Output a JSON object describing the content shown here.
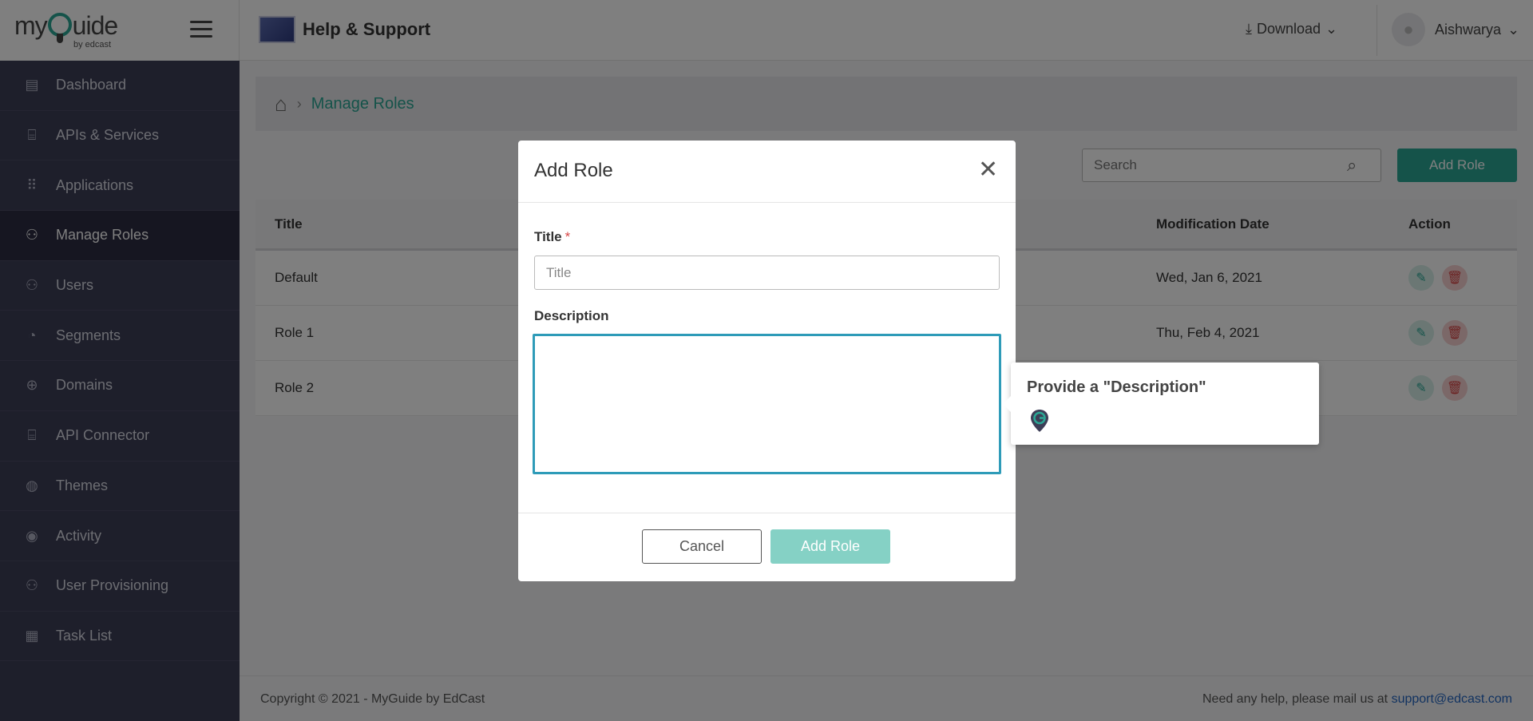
{
  "sidebar": {
    "logo_text": "my",
    "logo_text2": "uide",
    "logo_sub": "by edcast",
    "items": [
      {
        "label": "Dashboard",
        "icon": "dashboard-icon"
      },
      {
        "label": "APIs & Services",
        "icon": "api-icon"
      },
      {
        "label": "Applications",
        "icon": "grid-icon"
      },
      {
        "label": "Manage Roles",
        "icon": "user-roles-icon",
        "active": true
      },
      {
        "label": "Users",
        "icon": "users-icon"
      },
      {
        "label": "Segments",
        "icon": "pie-icon"
      },
      {
        "label": "Domains",
        "icon": "globe-icon"
      },
      {
        "label": "API Connector",
        "icon": "api-connector-icon"
      },
      {
        "label": "Themes",
        "icon": "palette-icon"
      },
      {
        "label": "Activity",
        "icon": "activity-icon"
      },
      {
        "label": "User Provisioning",
        "icon": "user-provisioning-icon"
      },
      {
        "label": "Task List",
        "icon": "clipboard-icon"
      }
    ]
  },
  "header": {
    "title": "Help & Support",
    "download_label": "Download",
    "username": "Aishwarya"
  },
  "breadcrumb": {
    "current": "Manage Roles"
  },
  "toolbar": {
    "search_placeholder": "Search",
    "add_role_label": "Add Role"
  },
  "table": {
    "headers": {
      "title": "Title",
      "modification_date": "Modification Date",
      "action": "Action"
    },
    "rows": [
      {
        "title": "Default",
        "date": "Wed, Jan 6, 2021"
      },
      {
        "title": "Role 1",
        "date": "Thu, Feb 4, 2021"
      },
      {
        "title": "Role 2",
        "date": ""
      }
    ]
  },
  "footer": {
    "copyright": "Copyright © 2021 - MyGuide by EdCast",
    "help_text": "Need any help, please mail us at",
    "email": "support@edcast.com"
  },
  "modal": {
    "title": "Add Role",
    "title_label": "Title",
    "required_mark": "*",
    "title_placeholder": "Title",
    "title_value": "",
    "description_label": "Description",
    "description_value": "",
    "cancel_label": "Cancel",
    "submit_label": "Add Role"
  },
  "tooltip": {
    "text": "Provide a \"Description\""
  },
  "colors": {
    "accent": "#2aa795",
    "sidebar_bg": "#3d3e57",
    "focus_border": "#2e9bb8",
    "link": "#2566c2"
  }
}
